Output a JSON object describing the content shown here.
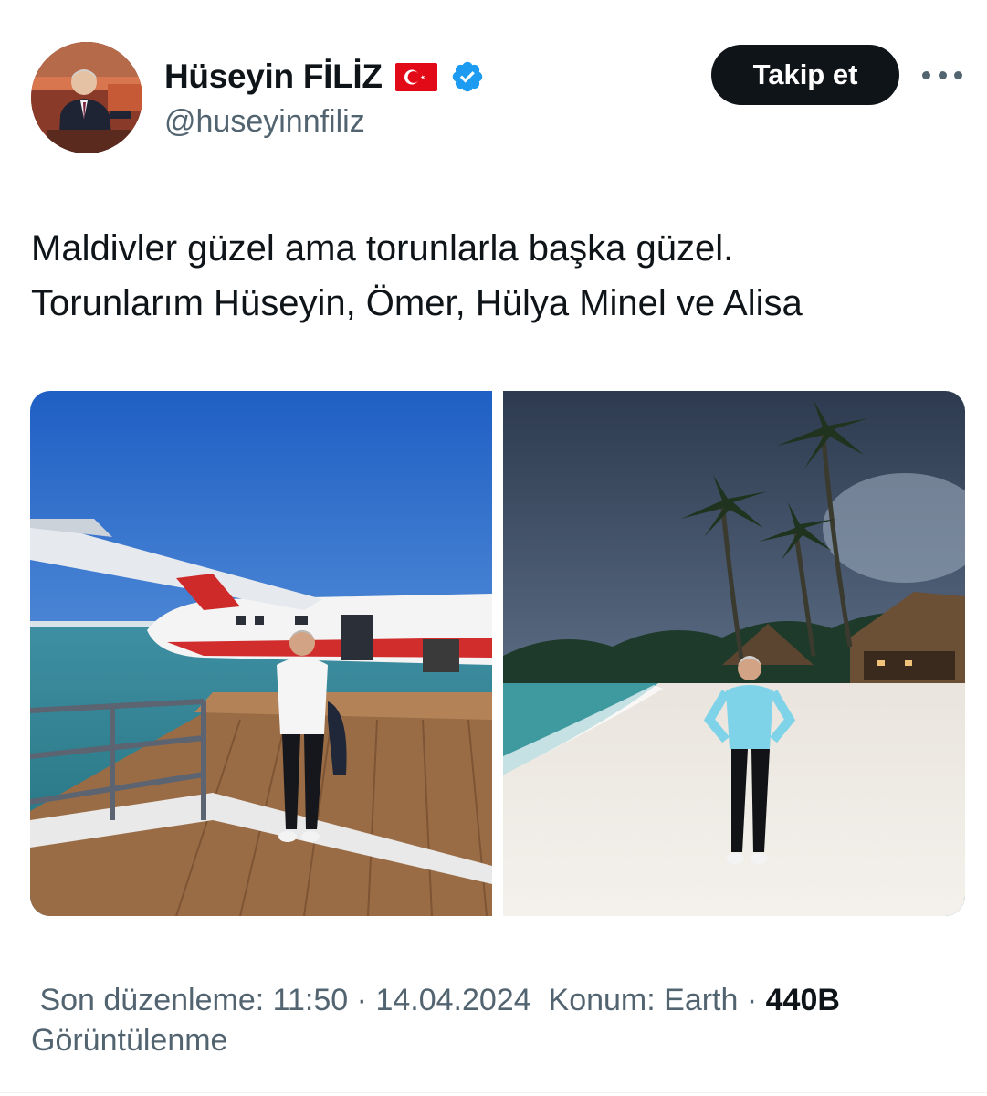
{
  "author": {
    "display_name": "Hüseyin FİLİZ",
    "handle": "@huseyinnfiliz",
    "flag_icon": "turkey-flag-icon",
    "verified_icon": "verified-badge-icon",
    "verified_color": "#1d9bf0"
  },
  "actions": {
    "follow_label": "Takip et",
    "more_icon": "more-horizontal-icon"
  },
  "tweet": {
    "text_lines": [
      "Maldivler güzel ama torunlarla başka güzel.",
      "Torunlarım Hüseyin, Ömer, Hülya Minel ve Alisa"
    ]
  },
  "media": {
    "photo_count": 2
  },
  "meta": {
    "edited_label": "Son düzenleme:",
    "time": "11:50",
    "separator": "·",
    "date": "14.04.2024",
    "location_label": "Konum: Earth",
    "views_count": "440B",
    "views_label": "Görüntülenme"
  },
  "colors": {
    "text": "#0f1419",
    "secondary": "#536471",
    "button_bg": "#0f1419",
    "button_text": "#ffffff"
  }
}
